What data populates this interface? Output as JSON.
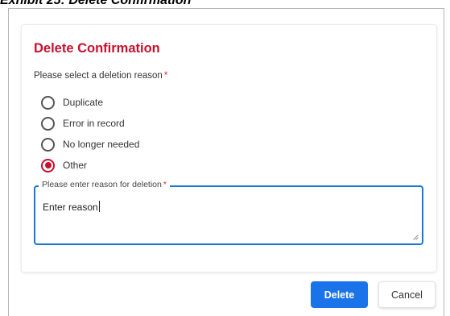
{
  "exhibit": {
    "title": "Exhibit 25: Delete Confirmation"
  },
  "dialog": {
    "title": "Delete Confirmation",
    "reason_label": "Please select a deletion reason",
    "required_marker": "*",
    "options": [
      {
        "label": "Duplicate",
        "checked": false
      },
      {
        "label": "Error in record",
        "checked": false
      },
      {
        "label": "No longer needed",
        "checked": false
      },
      {
        "label": "Other",
        "checked": true
      }
    ],
    "textarea": {
      "label": "Please enter reason for deletion",
      "required_marker": "*",
      "value": "Enter reason"
    }
  },
  "buttons": {
    "delete_label": "Delete",
    "cancel_label": "Cancel"
  },
  "colors": {
    "title": "#c8102e",
    "radio_checked": "#c8102e",
    "required": "#d32f2f",
    "focus_border": "#1976d2",
    "primary_button": "#1a73e8"
  }
}
